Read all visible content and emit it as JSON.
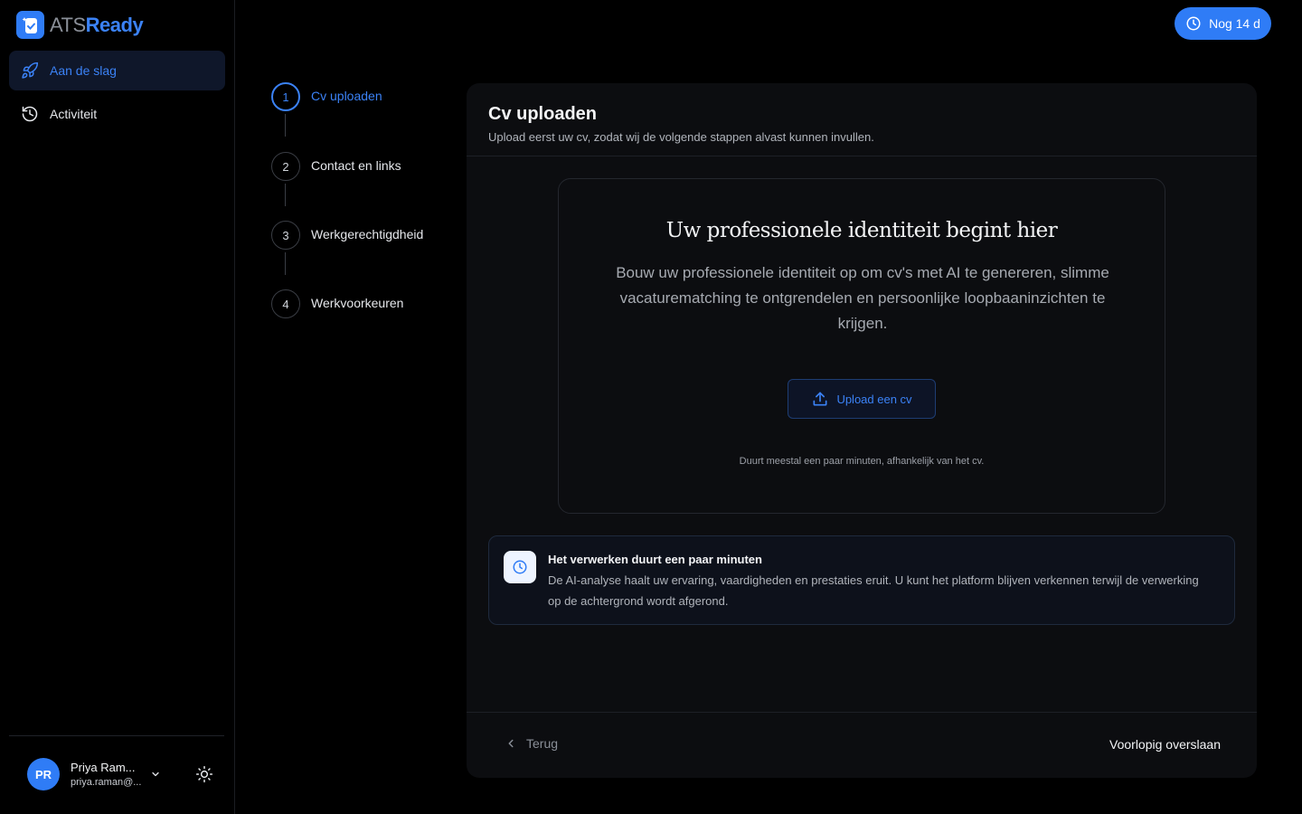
{
  "brand": {
    "part1": "ATS",
    "part2": "Ready"
  },
  "sidebar": {
    "items": [
      {
        "label": "Aan de slag",
        "icon": "rocket-icon",
        "active": true
      },
      {
        "label": "Activiteit",
        "icon": "history-icon",
        "active": false
      }
    ]
  },
  "user": {
    "initials": "PR",
    "name": "Priya Ram...",
    "email": "priya.raman@..."
  },
  "trial": {
    "label": "Nog 14 d"
  },
  "steps": [
    {
      "number": "1",
      "label": "Cv uploaden"
    },
    {
      "number": "2",
      "label": "Contact en links"
    },
    {
      "number": "3",
      "label": "Werkgerechtigdheid"
    },
    {
      "number": "4",
      "label": "Werkvoorkeuren"
    }
  ],
  "card": {
    "title": "Cv uploaden",
    "subtitle": "Upload eerst uw cv, zodat wij de volgende stappen alvast kunnen invullen."
  },
  "upload": {
    "heading": "Uw professionele identiteit begint hier",
    "description": "Bouw uw professionele identiteit op om cv's met AI te genereren, slimme vacaturematching te ontgrendelen en persoonlijke loopbaaninzichten te krijgen.",
    "button_label": "Upload een cv",
    "note": "Duurt meestal een paar minuten, afhankelijk van het cv."
  },
  "info": {
    "title": "Het verwerken duurt een paar minuten",
    "text": "De AI-analyse haalt uw ervaring, vaardigheden en prestaties eruit. U kunt het platform blijven verkennen terwijl de verwerking op de achtergrond wordt afgerond."
  },
  "footer": {
    "back_label": "Terug",
    "skip_label": "Voorlopig overslaan"
  },
  "colors": {
    "accent": "#2f7cf6",
    "background": "#000000",
    "card": "#0c0d10"
  }
}
